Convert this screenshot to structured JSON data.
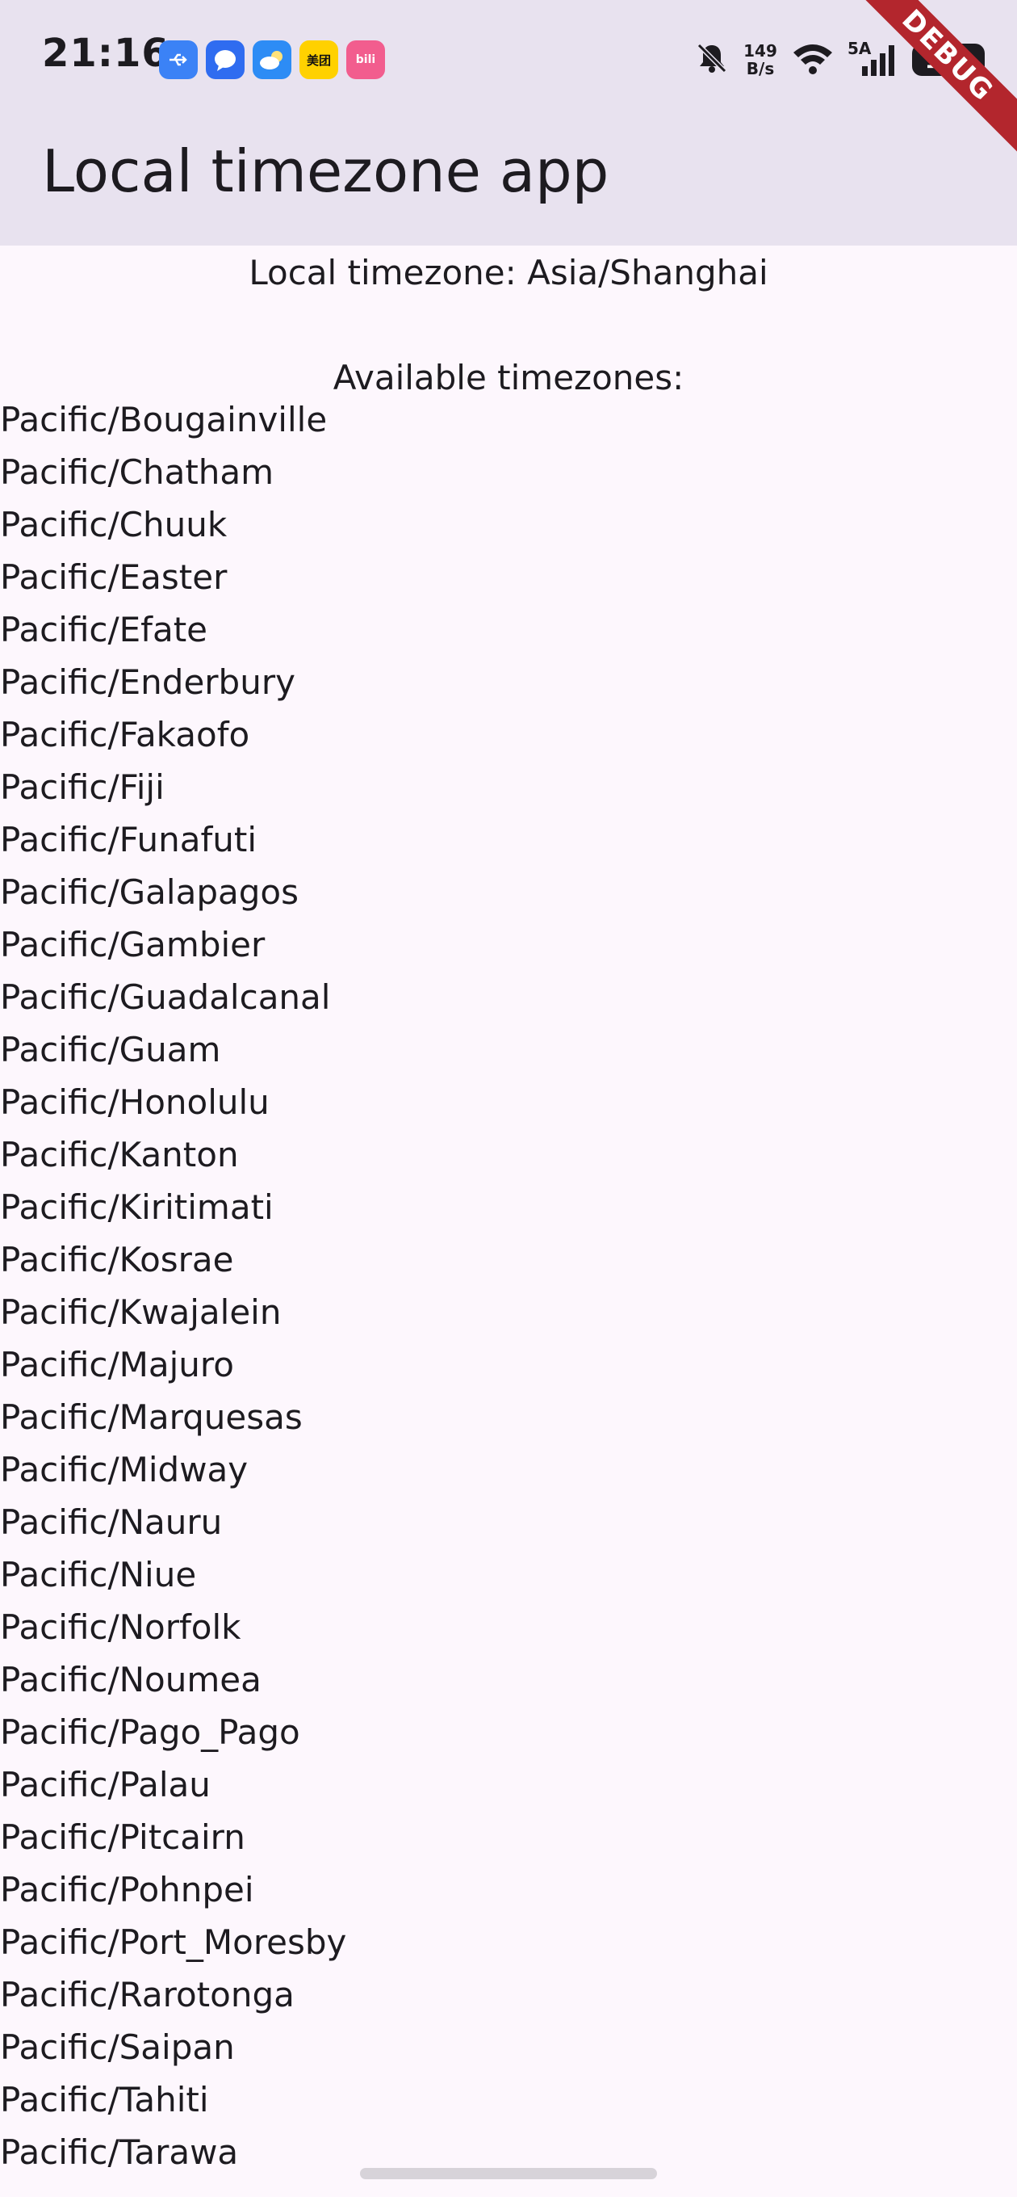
{
  "status_bar": {
    "time": "21:16",
    "net_speed_value": "149",
    "net_speed_unit": "B/s",
    "network_type": "5A",
    "battery": "100",
    "notification_icons": [
      "usb-icon",
      "messages-icon",
      "weather-icon",
      "meituan-icon",
      "bilibili-icon"
    ],
    "meituan_label": "美团",
    "bilibili_label": "bili"
  },
  "app_bar": {
    "title": "Local timezone app"
  },
  "debug_banner": "DEBUG",
  "main": {
    "local_timezone": "Local timezone: Asia/Shanghai",
    "available_heading": "Available timezones:",
    "timezones": [
      "Pacific/Bougainville",
      "Pacific/Chatham",
      "Pacific/Chuuk",
      "Pacific/Easter",
      "Pacific/Efate",
      "Pacific/Enderbury",
      "Pacific/Fakaofo",
      "Pacific/Fiji",
      "Pacific/Funafuti",
      "Pacific/Galapagos",
      "Pacific/Gambier",
      "Pacific/Guadalcanal",
      "Pacific/Guam",
      "Pacific/Honolulu",
      "Pacific/Kanton",
      "Pacific/Kiritimati",
      "Pacific/Kosrae",
      "Pacific/Kwajalein",
      "Pacific/Majuro",
      "Pacific/Marquesas",
      "Pacific/Midway",
      "Pacific/Nauru",
      "Pacific/Niue",
      "Pacific/Norfolk",
      "Pacific/Noumea",
      "Pacific/Pago_Pago",
      "Pacific/Palau",
      "Pacific/Pitcairn",
      "Pacific/Pohnpei",
      "Pacific/Port_Moresby",
      "Pacific/Rarotonga",
      "Pacific/Saipan",
      "Pacific/Tahiti",
      "Pacific/Tarawa"
    ]
  },
  "colors": {
    "app_bar_bg": "#e8e2ef",
    "page_bg": "#fdf7fd",
    "text": "#1d1b20",
    "debug_ribbon": "#b3262d"
  }
}
